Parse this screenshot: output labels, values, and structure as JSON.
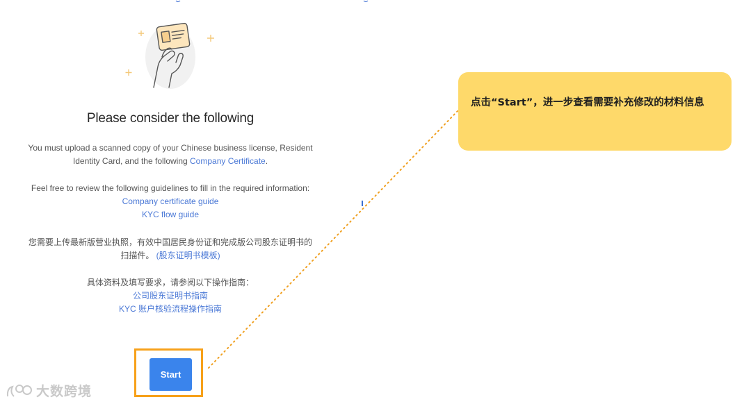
{
  "content": {
    "title": "Please consider the following",
    "upload_text_1": "You must upload a scanned copy of your Chinese business license, Resident Identity Card, and the following ",
    "company_certificate_link": "Company Certificate",
    "upload_text_end": ".",
    "guidelines_text": "Feel free to review the following guidelines to fill in the required information:",
    "company_certificate_guide_link": "Company certificate guide",
    "kyc_flow_guide_link": "KYC flow guide",
    "cn_upload_text": "您需要上传最新版营业执照，有效中国居民身份证和完成版公司股东证明书的扫描件。",
    "cn_template_link": "(股东证明书模板)",
    "cn_guidelines_text": "具体资料及填写要求，请参阅以下操作指南：",
    "cn_certificate_guide_link": "公司股东证明书指南",
    "cn_kyc_guide_link": "KYC 账户核验流程操作指南",
    "start_button": "Start"
  },
  "callout": {
    "text": "点击“Start”，进一步查看需要补充修改的材料信息",
    "background": "#fed96a"
  },
  "watermark": {
    "text": "大数跨境",
    "icon": "logo-icon"
  },
  "colors": {
    "link": "#4a78d6",
    "button": "#3a84ec",
    "highlight_frame": "#f7a11a",
    "connector": "#f0a020"
  },
  "icons": {
    "illustration": "hand-holding-id-card-icon",
    "sparkles": "sparkle-icon"
  }
}
